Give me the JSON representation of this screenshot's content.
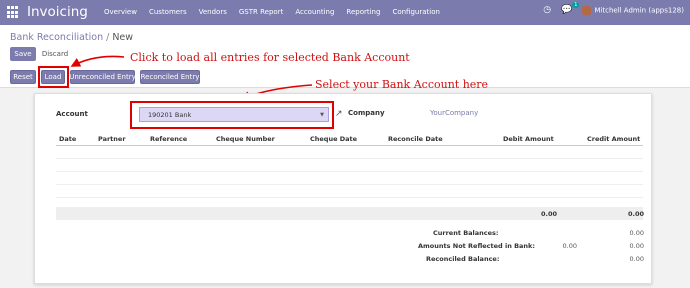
{
  "navbar": {
    "app_name": "Invoicing",
    "menu": [
      "Overview",
      "Customers",
      "Vendors",
      "GSTR Report",
      "Accounting",
      "Reporting",
      "Configuration"
    ],
    "messages_badge": "1",
    "user": "Mitchell Admin (apps128)"
  },
  "breadcrumb": {
    "parent": "Bank Reconciliation",
    "separator": "/",
    "current": "New"
  },
  "buttons": {
    "save": "Save",
    "discard": "Discard",
    "reset": "Reset",
    "load": "Load",
    "unreconciled": "Unreconciled Entry",
    "reconciled": "Reconciled Entry"
  },
  "annotations": {
    "load_hint": "Click to load all entries for selected Bank Account",
    "account_hint": "Select your Bank Account here"
  },
  "form": {
    "account_label": "Account",
    "account_value": "190201 Bank",
    "company_label": "Company",
    "company_value": "YourCompany"
  },
  "table": {
    "columns": [
      "Date",
      "Partner",
      "Reference",
      "Cheque Number",
      "Cheque Date",
      "Reconcile Date",
      "Debit Amount",
      "Credit Amount"
    ],
    "debit_total": "0.00",
    "credit_total": "0.00"
  },
  "summary": {
    "current_balances_label": "Current Balances:",
    "current_balances_value": "0.00",
    "not_reflected_label": "Amounts Not Reflected in Bank:",
    "not_reflected_debit": "0.00",
    "not_reflected_credit": "0.00",
    "reconciled_label": "Reconciled Balance:",
    "reconciled_value": "0.00"
  },
  "colors": {
    "brand": "#7c7bad",
    "annotation": "#d01010",
    "select_bg": "#dcd7f5"
  }
}
